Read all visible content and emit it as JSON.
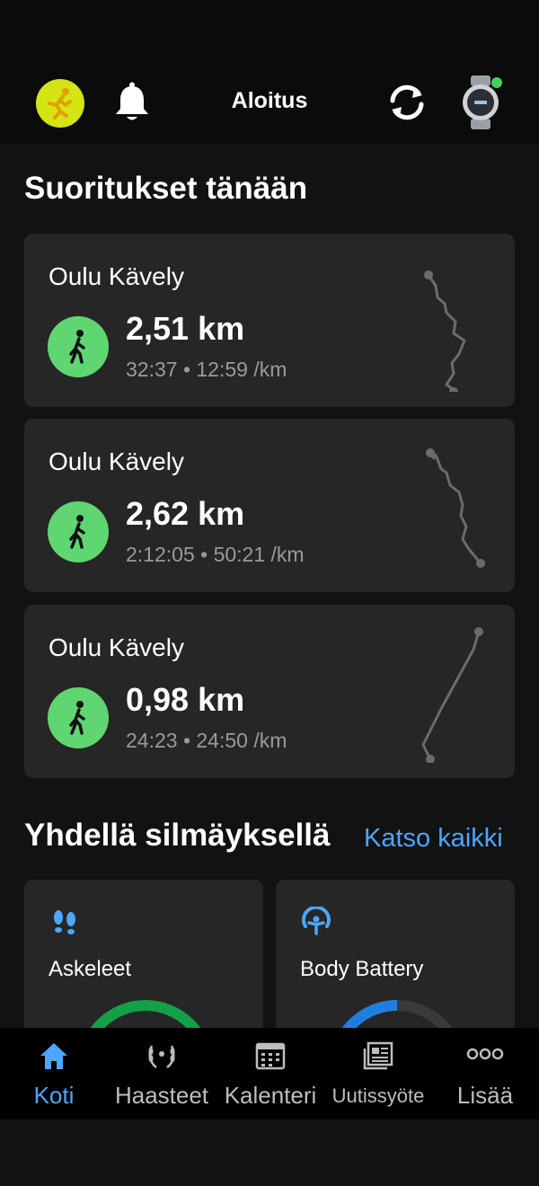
{
  "header": {
    "title": "Aloitus"
  },
  "icons": {
    "avatar": "runner-avatar-icon",
    "bell": "bell-icon",
    "sync": "sync-icon",
    "watch": "watch-icon"
  },
  "today": {
    "title": "Suoritukset tänään",
    "activities": [
      {
        "name": "Oulu Kävely",
        "distance": "2,51 km",
        "meta": "32:37 • 12:59 /km"
      },
      {
        "name": "Oulu Kävely",
        "distance": "2,62 km",
        "meta": "2:12:05 • 50:21 /km"
      },
      {
        "name": "Oulu Kävely",
        "distance": "0,98 km",
        "meta": "24:23 • 24:50 /km"
      }
    ]
  },
  "glance": {
    "title": "Yhdellä silmäyksellä",
    "see_all": "Katso kaikki",
    "cards": [
      {
        "label": "Askeleet",
        "icon": "footsteps-icon"
      },
      {
        "label": "Body Battery",
        "icon": "body-battery-icon"
      }
    ]
  },
  "nav": {
    "items": [
      {
        "label": "Koti",
        "icon": "home-icon",
        "active": true
      },
      {
        "label": "Haasteet",
        "icon": "laurel-icon",
        "active": false
      },
      {
        "label": "Kalenteri",
        "icon": "calendar-icon",
        "active": false
      },
      {
        "label": "Uutissyöte",
        "icon": "newsfeed-icon",
        "active": false
      },
      {
        "label": "Lisää",
        "icon": "more-icon",
        "active": false
      }
    ]
  },
  "colors": {
    "accent": "#4da6ff",
    "activity_green": "#5fd672",
    "avatar_yellow": "#d4e414",
    "status_dot": "#3fd35a",
    "steps_ring": "#14a046",
    "battery_ring": "#1f7fe0"
  }
}
